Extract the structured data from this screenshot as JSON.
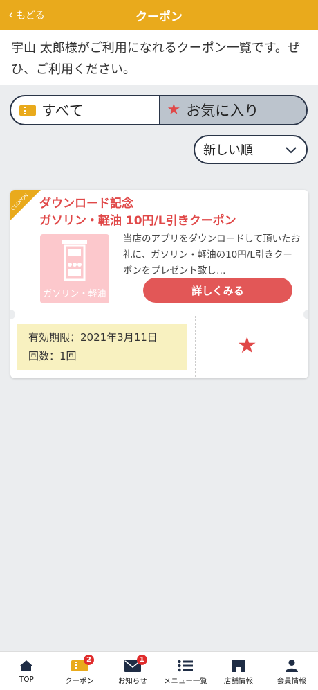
{
  "header": {
    "back_label": "もどる",
    "title": "クーポン"
  },
  "intro": {
    "text": "宇山 太郎様がご利用になれるクーポン一覧です。ぜひ、ご利用ください。"
  },
  "tabs": [
    {
      "label": "すべて",
      "icon": "ticket-icon",
      "active": true
    },
    {
      "label": "お気に入り",
      "icon": "star-icon",
      "active": false
    }
  ],
  "sort": {
    "selected": "新しい順"
  },
  "coupon": {
    "corner_label": "COUPON",
    "title_line1": "ダウンロード記念",
    "title_line2": "ガソリン・軽油 10円/L引きクーポン",
    "thumb_label": "ガソリン・軽油",
    "description": "当店のアプリをダウンロードして頂いたお礼に、ガソリン・軽油の10円/L引きクーポンをプレゼント致し…",
    "detail_button": "詳しくみる",
    "expiry": "有効期限：2021年3月11日",
    "count": "回数：1回",
    "favorite": true
  },
  "nav": [
    {
      "label": "TOP",
      "icon": "home-icon",
      "badge": ""
    },
    {
      "label": "クーポン",
      "icon": "coupon-icon",
      "badge": "2"
    },
    {
      "label": "お知らせ",
      "icon": "mail-icon",
      "badge": "1"
    },
    {
      "label": "メニュー一覧",
      "icon": "menu-list-icon",
      "badge": ""
    },
    {
      "label": "店舗情報",
      "icon": "store-icon",
      "badge": ""
    },
    {
      "label": "会員情報",
      "icon": "user-icon",
      "badge": ""
    }
  ],
  "colors": {
    "accent": "#e9aa1c",
    "red": "#e25757",
    "navy": "#2a3548"
  }
}
